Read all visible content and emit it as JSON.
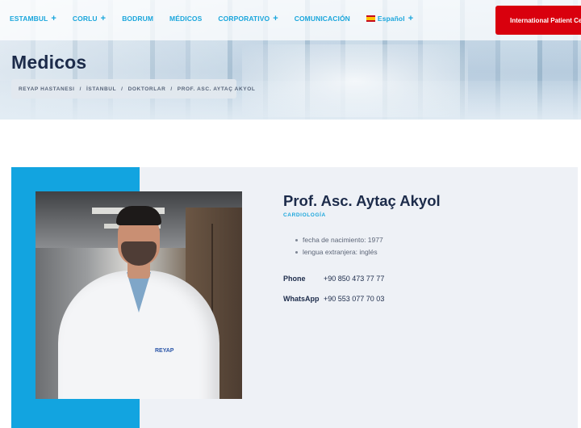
{
  "nav": {
    "items": [
      {
        "label": "ESTAMBUL",
        "has_submenu": true
      },
      {
        "label": "CORLU",
        "has_submenu": true
      },
      {
        "label": "BODRUM",
        "has_submenu": false
      },
      {
        "label": "MÉDICOS",
        "has_submenu": false
      },
      {
        "label": "CORPORATIVO",
        "has_submenu": true
      },
      {
        "label": "COMUNICACIÓN",
        "has_submenu": false
      }
    ],
    "language": {
      "label": "Español",
      "has_submenu": true
    },
    "cta_label": "International Patient Center",
    "plus_symbol": "+"
  },
  "header": {
    "title": "Medicos",
    "breadcrumb": [
      "REYAP HASTANESI",
      "İSTANBUL",
      "DOKTORLAR",
      "PROF. ASC. AYTAÇ AKYOL"
    ],
    "breadcrumb_separator": "/"
  },
  "doctor": {
    "name": "Prof. Asc. Aytaç Akyol",
    "specialty": "CARDIOLOGÍA",
    "facts": [
      "fecha de nacimiento: 1977",
      "lengua extranjera: inglés"
    ],
    "contacts": [
      {
        "label": "Phone",
        "value": "+90 850 473 77 77"
      },
      {
        "label": "WhatsApp",
        "value": "+90 553 077 70 03"
      }
    ],
    "coat_logo": "REYAP"
  },
  "colors": {
    "accent_blue": "#12a4e0",
    "nav_blue": "#1aa6dc",
    "cta_red": "#d9000d",
    "heading_navy": "#1c2b4a",
    "card_bg": "#eef1f6"
  }
}
